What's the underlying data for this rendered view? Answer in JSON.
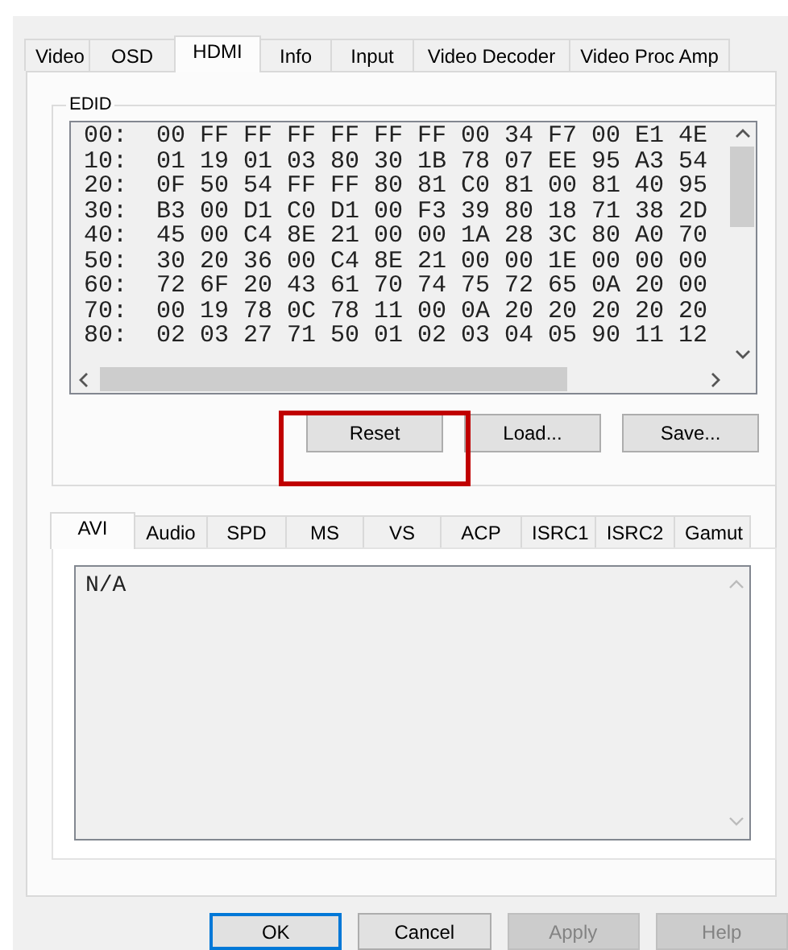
{
  "tabs": [
    {
      "label": "Video",
      "selected": false
    },
    {
      "label": "OSD",
      "selected": false
    },
    {
      "label": "HDMI",
      "selected": true
    },
    {
      "label": "Info",
      "selected": false
    },
    {
      "label": "Input",
      "selected": false
    },
    {
      "label": "Video Decoder",
      "selected": false
    },
    {
      "label": "Video Proc Amp",
      "selected": false
    }
  ],
  "edid": {
    "title": "EDID",
    "rows": [
      "00:  00 FF FF FF FF FF FF 00 34 F7 00 E1 4E",
      "10:  01 19 01 03 80 30 1B 78 07 EE 95 A3 54",
      "20:  0F 50 54 FF FF 80 81 C0 81 00 81 40 95",
      "30:  B3 00 D1 C0 D1 00 F3 39 80 18 71 38 2D",
      "40:  45 00 C4 8E 21 00 00 1A 28 3C 80 A0 70",
      "50:  30 20 36 00 C4 8E 21 00 00 1E 00 00 00",
      "60:  72 6F 20 43 61 70 74 75 72 65 0A 20 00",
      "70:  00 19 78 0C 78 11 00 0A 20 20 20 20 20",
      "80:  02 03 27 71 50 01 02 03 04 05 90 11 12"
    ],
    "buttons": [
      {
        "label": "Reset",
        "highlighted": true
      },
      {
        "label": "Load...",
        "highlighted": false
      },
      {
        "label": "Save...",
        "highlighted": false
      }
    ]
  },
  "infoframe_tabs": [
    {
      "label": "AVI",
      "selected": true
    },
    {
      "label": "Audio",
      "selected": false
    },
    {
      "label": "SPD",
      "selected": false
    },
    {
      "label": "MS",
      "selected": false
    },
    {
      "label": "VS",
      "selected": false
    },
    {
      "label": "ACP",
      "selected": false
    },
    {
      "label": "ISRC1",
      "selected": false
    },
    {
      "label": "ISRC2",
      "selected": false
    },
    {
      "label": "Gamut",
      "selected": false
    }
  ],
  "infoframe_text": "N/A",
  "dialog_buttons": [
    {
      "label": "OK",
      "default": true,
      "disabled": false
    },
    {
      "label": "Cancel",
      "default": false,
      "disabled": false
    },
    {
      "label": "Apply",
      "default": false,
      "disabled": true
    },
    {
      "label": "Help",
      "default": false,
      "disabled": true
    }
  ]
}
